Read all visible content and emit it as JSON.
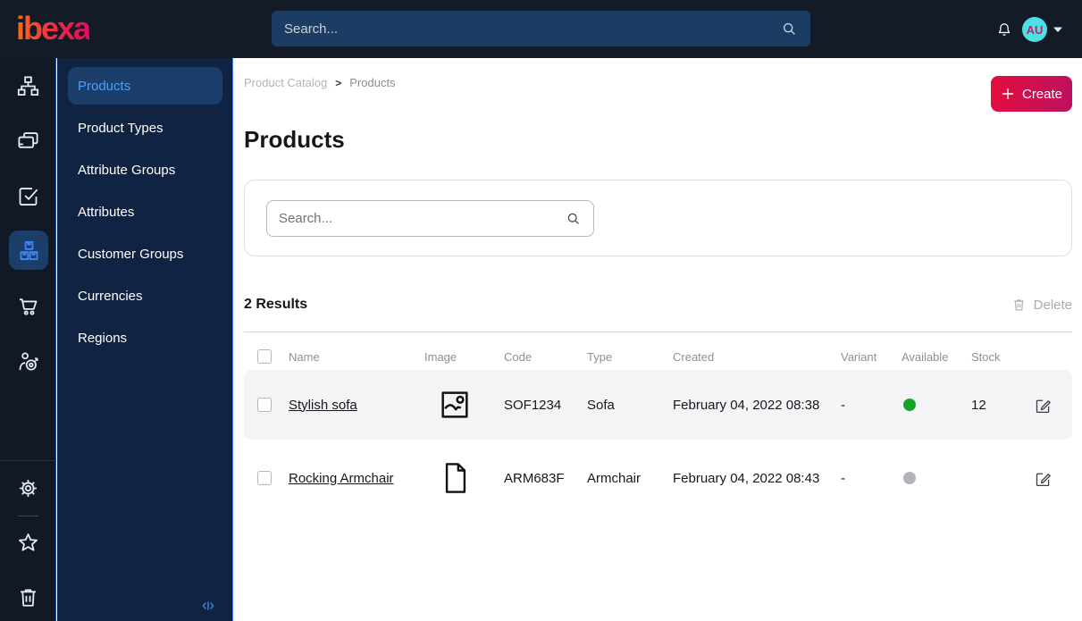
{
  "topbar": {
    "logo_text": "ibexa",
    "search_placeholder": "Search...",
    "avatar_initials": "AU"
  },
  "sidebar": {
    "items": [
      {
        "label": "Products"
      },
      {
        "label": "Product Types"
      },
      {
        "label": "Attribute Groups"
      },
      {
        "label": "Attributes"
      },
      {
        "label": "Customer Groups"
      },
      {
        "label": "Currencies"
      },
      {
        "label": "Regions"
      }
    ]
  },
  "main": {
    "breadcrumb": {
      "parent": "Product Catalog",
      "current": "Products"
    },
    "create_label": "Create",
    "page_title": "Products",
    "filter_search_placeholder": "Search...",
    "results_label": "2 Results",
    "delete_label": "Delete",
    "table": {
      "columns": [
        "Name",
        "Image",
        "Code",
        "Type",
        "Created",
        "Variant",
        "Available",
        "Stock"
      ],
      "rows": [
        {
          "name": "Stylish sofa",
          "code": "SOF1234",
          "type": "Sofa",
          "created": "February 04, 2022 08:38",
          "variant": "-",
          "available_color": "#16a329",
          "stock": "12"
        },
        {
          "name": "Rocking Armchair",
          "code": "ARM683F",
          "type": "Armchair",
          "created": "February 04, 2022 08:43",
          "variant": "-",
          "available_color": "#b1b5ba",
          "stock": ""
        }
      ]
    }
  },
  "colors": {
    "accent_blue": "#3e87f8",
    "brand_gradient_start": "#ff6a13",
    "brand_gradient_end": "#e00d5b",
    "create_gradient_start": "#e30e3c",
    "create_gradient_end": "#bc1061",
    "available_green": "#16a329",
    "unavailable_gray": "#b1b5ba"
  }
}
